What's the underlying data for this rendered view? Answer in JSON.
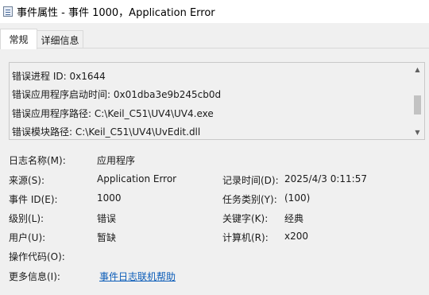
{
  "window": {
    "title": "事件属性 - 事件 1000，Application Error"
  },
  "tabs": [
    {
      "label": "常规",
      "active": true
    },
    {
      "label": "详细信息",
      "active": false
    }
  ],
  "description": {
    "lines": [
      "错误进程 ID: 0x1644",
      "错误应用程序启动时间: 0x01dba3e9b245cb0d",
      "错误应用程序路径: C:\\Keil_C51\\UV4\\UV4.exe",
      "错误模块路径: C:\\Keil_C51\\UV4\\UvEdit.dll"
    ],
    "scrollbar": {
      "up_icon": "chevron-up-icon",
      "down_icon": "chevron-down-icon",
      "thumb_fraction": 0.35
    }
  },
  "fields": {
    "log_name_label": "日志名称(M):",
    "log_name_value": "应用程序",
    "source_label": "来源(S):",
    "source_value": "Application Error",
    "logged_label": "记录时间(D):",
    "logged_value": "2025/4/3 0:11:57",
    "event_id_label": "事件 ID(E):",
    "event_id_value": "1000",
    "task_label": "任务类别(Y):",
    "task_value": "(100)",
    "level_label": "级别(L):",
    "level_value": "错误",
    "keywords_label": "关键字(K):",
    "keywords_value": "经典",
    "user_label": "用户(U):",
    "user_value": "暂缺",
    "computer_label": "计算机(R):",
    "computer_value": "x200",
    "opcode_label": "操作代码(O):",
    "opcode_value": "",
    "more_info_label": "更多信息(I):",
    "more_info_link": "事件日志联机帮助"
  },
  "colors": {
    "link": "#0b5cb8",
    "background": "#f0f0f0"
  }
}
